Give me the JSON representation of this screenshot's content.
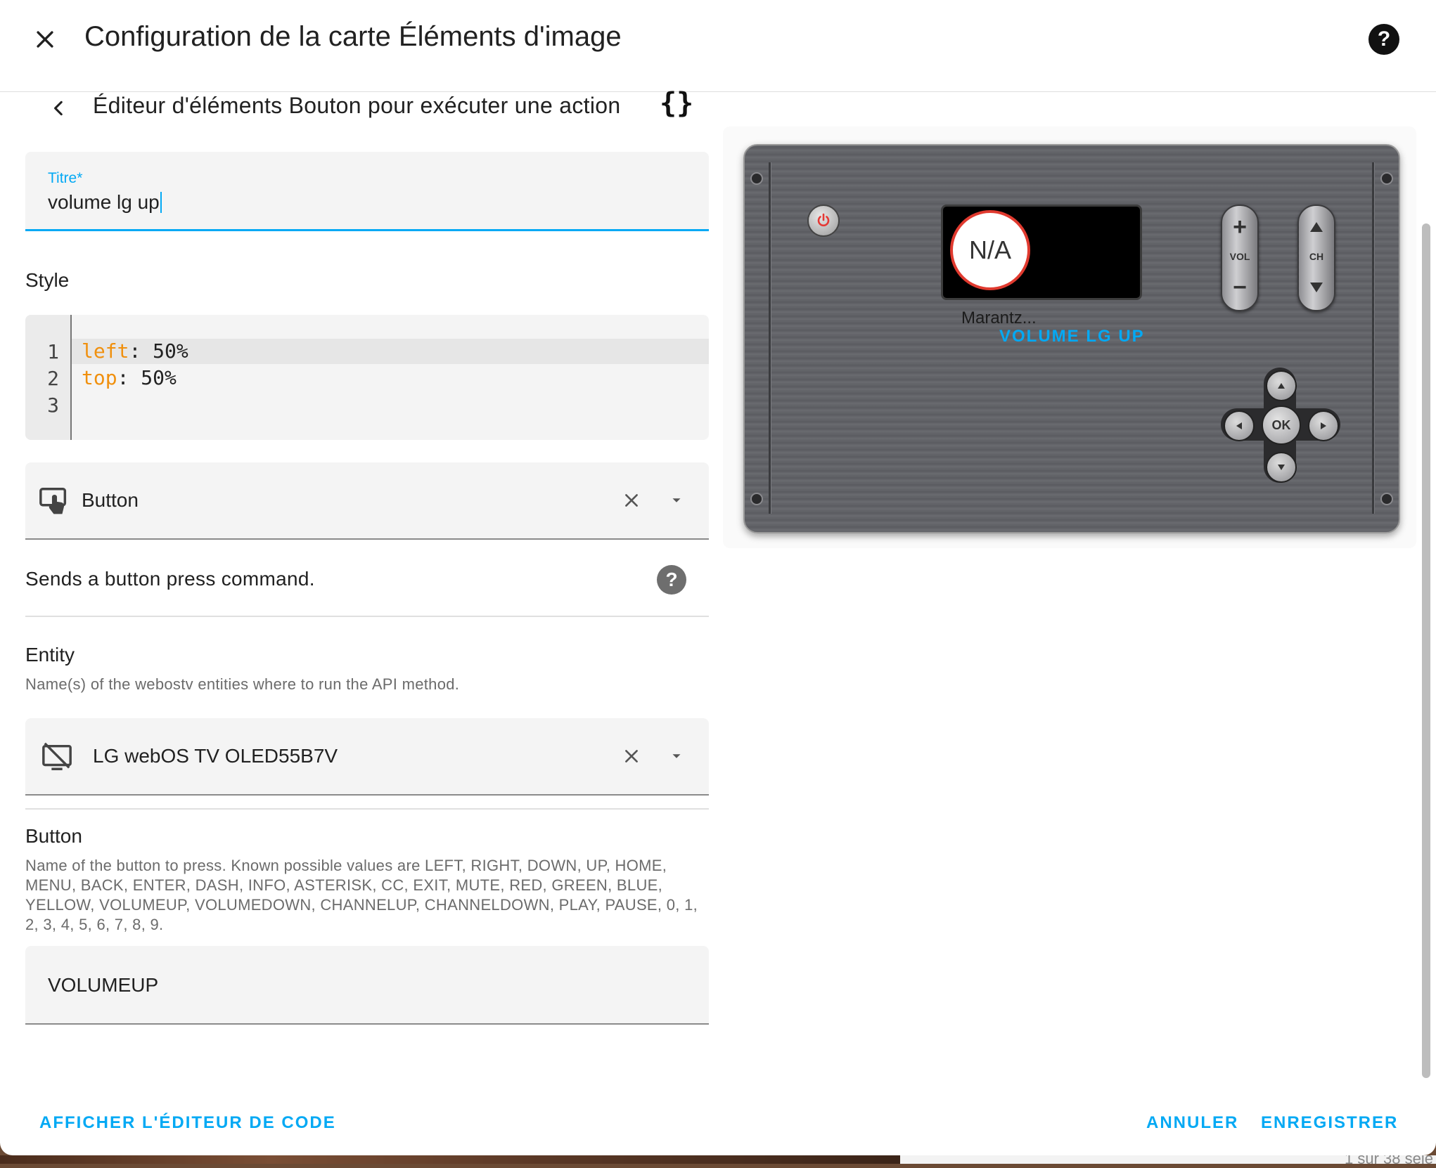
{
  "background": {
    "counter_text": "1 sur 38 séle"
  },
  "dialog": {
    "title": "Configuration de la carte Éléments d'image",
    "close_icon": "close-icon",
    "help_icon": "help-icon"
  },
  "editor": {
    "subtitle": "Éditeur d'éléments Bouton pour exécuter une action",
    "yaml_toggle": "{}",
    "title_field": {
      "label": "Titre*",
      "value": "volume lg up"
    },
    "style": {
      "label": "Style",
      "line_numbers": [
        "1",
        "2",
        "3"
      ],
      "lines": [
        {
          "key": "left",
          "value": ": 50%"
        },
        {
          "key": "top",
          "value": ": 50%"
        }
      ]
    },
    "action_select": {
      "value": "Button",
      "icon": "gesture-tap-button-icon"
    },
    "action_description": "Sends a button press command.",
    "entity": {
      "label": "Entity",
      "description": "Name(s) of the webostv entities where to run the API method.",
      "value": "LG webOS TV OLED55B7V",
      "icon": "tv-off-icon"
    },
    "button": {
      "label": "Button",
      "description": "Name of the button to press. Known possible values are LEFT, RIGHT, DOWN, UP, HOME, MENU, BACK, ENTER, DASH, INFO, ASTERISK, CC, EXIT, MUTE, RED, GREEN, BLUE, YELLOW, VOLUMEUP, VOLUMEDOWN, CHANNELUP, CHANNELDOWN, PLAY, PAUSE, 0, 1, 2, 3, 4, 5, 6, 7, 8, 9.",
      "value": "VOLUMEUP"
    }
  },
  "preview": {
    "badge_text": "N/A",
    "device_name": "Marantz...",
    "element_label": "VOLUME LG UP",
    "vol_label": "VOL",
    "ch_label": "CH",
    "plus": "+",
    "minus": "−",
    "ok_label": "OK",
    "colors": {
      "remote_body": "#5f6065",
      "power_red": "#e53935",
      "badge_border": "#e03a2f",
      "accent": "#03a9f4"
    }
  },
  "footer": {
    "show_code_editor": "AFFICHER L'ÉDITEUR DE CODE",
    "cancel": "ANNULER",
    "save": "ENREGISTRER"
  }
}
